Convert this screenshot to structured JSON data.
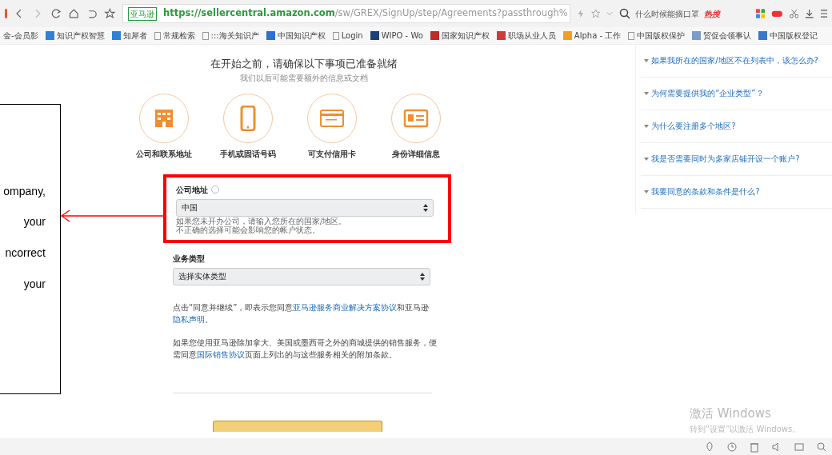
{
  "browser": {
    "site_badge": "亚马逊",
    "url_host": "https://sellercentral.amazon.com",
    "url_path": "/sw/GREX/SignUp/step/Agreements?passthrough%",
    "search_text": "什么时候能摘口罩",
    "hot_label": "热搜"
  },
  "bookmarks": [
    {
      "label": "金-会员影",
      "kind": "plain"
    },
    {
      "label": "知识产权智慧",
      "kind": "tile",
      "color": "#2f80d8"
    },
    {
      "label": "知犀者",
      "kind": "tile",
      "color": "#2f80d8"
    },
    {
      "label": "常规检索",
      "kind": "page"
    },
    {
      "label": ":::海关知识产",
      "kind": "page"
    },
    {
      "label": "中国知识产权",
      "kind": "tile",
      "color": "#2f6fd0"
    },
    {
      "label": "Login",
      "kind": "page"
    },
    {
      "label": "WIPO - Wo",
      "kind": "tile",
      "color": "#1f3f7a"
    },
    {
      "label": "国家知识产权",
      "kind": "tile",
      "color": "#c02a2a"
    },
    {
      "label": "职场从业人员",
      "kind": "tile",
      "color": "#d23a3a"
    },
    {
      "label": "Alpha - 工作",
      "kind": "tile",
      "color": "#f0a020"
    },
    {
      "label": "中国版权保护",
      "kind": "page"
    },
    {
      "label": "贸促会领事认",
      "kind": "tile",
      "color": "#7a9cc8"
    },
    {
      "label": "中国版权登记",
      "kind": "tile",
      "color": "#3a78c8"
    }
  ],
  "page": {
    "heading": "在开始之前，请确保以下事项已准备就绪",
    "subheading": "我们以后可能需要额外的信息或文档",
    "requirements": [
      {
        "kind": "building",
        "label": "公司和联系地址"
      },
      {
        "kind": "phone",
        "label": "手机或固话号码"
      },
      {
        "kind": "card",
        "label": "可支付信用卡"
      },
      {
        "kind": "id",
        "label": "身份详细信息"
      }
    ],
    "fields": [
      {
        "label": "公司地址",
        "help": true,
        "value": "中国",
        "hints": [
          "如果您未开办公司，请输入您所在的国家/地区。",
          "不正确的选择可能会影响您的帐户状态。"
        ],
        "highlighted": true
      },
      {
        "label": "业务类型",
        "help": false,
        "value": "选择实体类型",
        "highlighted": false
      }
    ],
    "paragraphs": [
      [
        {
          "text": "点击“同意并继续”，即表示您同意",
          "link": false
        },
        {
          "text": "亚马逊服务商业解决方案协议",
          "link": true
        },
        {
          "text": "和亚马逊",
          "link": false
        },
        {
          "text": "隐私声明",
          "link": true
        },
        {
          "text": "。",
          "link": false
        }
      ],
      [
        {
          "text": "如果您使用亚马逊除加拿大、美国或墨西哥之外的商城提供的销售服务，便需同意",
          "link": false
        },
        {
          "text": "国际销售协议",
          "link": true
        },
        {
          "text": "页面上列出的与这些服务相关的附加条款。",
          "link": false
        }
      ]
    ]
  },
  "faq": [
    "如果我所在的国家/地区不在列表中，该怎么办?",
    "为何需要提供我的“企业类型”？",
    "为什么要注册多个地区?",
    "我是否需要同时为多家店铺开设一个账户?",
    "我要同意的条款和条件是什么?"
  ],
  "callout": {
    "lines": [
      "ompany,",
      "your",
      "ncorrect",
      "your"
    ]
  },
  "activation": {
    "title": "激活 Windows",
    "subtitle": "转到“设置”以激活 Windows。"
  }
}
